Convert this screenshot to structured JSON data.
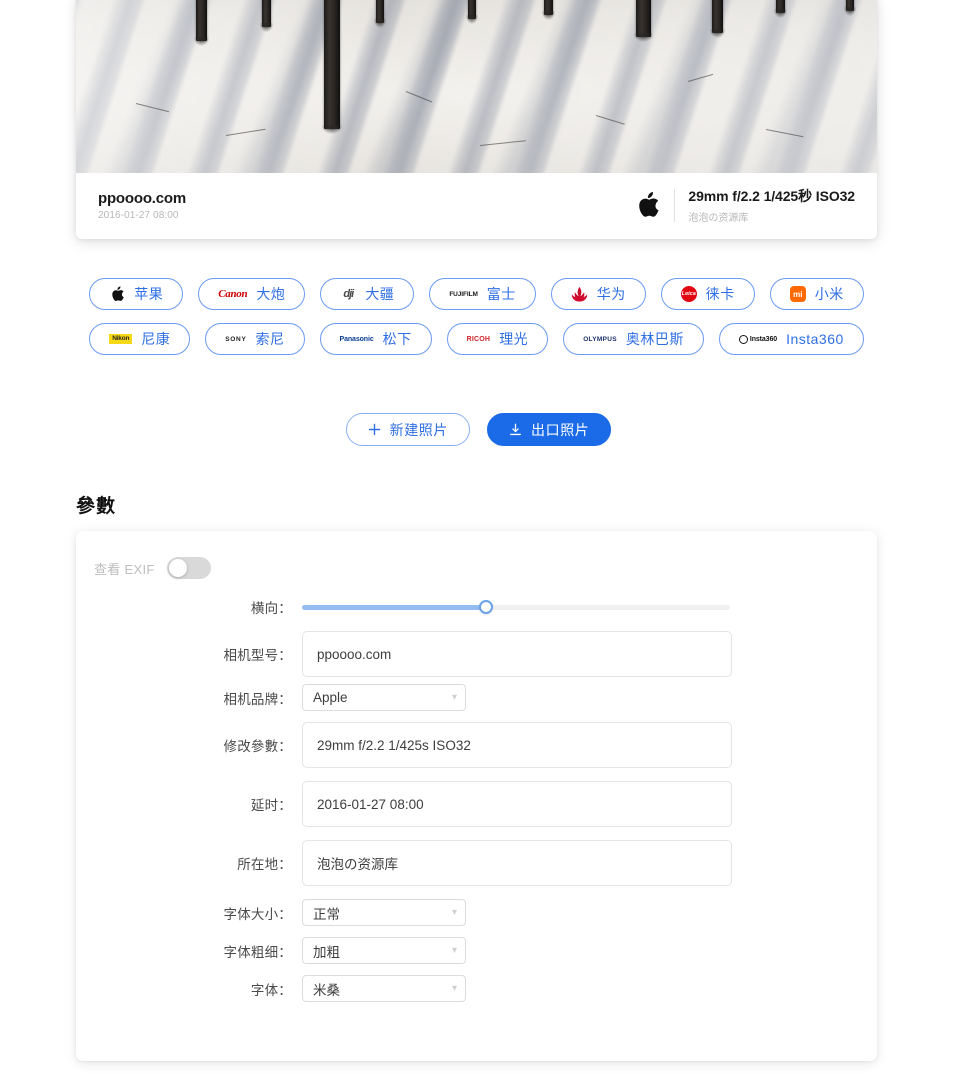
{
  "photo": {
    "alt_description": "snow-covered forest floor with dark tree trunks casting long shadows",
    "title": "ppoooo.com",
    "datetime": "2016-01-27 08:00",
    "brand_logo_icon": "apple-logo-icon",
    "params": "29mm f/2.2 1/425秒 ISO32",
    "owner": "泡泡の资源库"
  },
  "brands": [
    {
      "label": "苹果",
      "mark": "apple",
      "mark_text": "",
      "icon": "apple-logo-icon"
    },
    {
      "label": "大炮",
      "mark": "canon",
      "mark_text": "Canon",
      "icon": "canon-logo-icon"
    },
    {
      "label": "大疆",
      "mark": "dji",
      "mark_text": "dji",
      "icon": "dji-logo-icon"
    },
    {
      "label": "富士",
      "mark": "fuji",
      "mark_text": "FUJIFILM",
      "icon": "fujifilm-logo-icon"
    },
    {
      "label": "华为",
      "mark": "huawei",
      "mark_text": "HUAWEI",
      "icon": "huawei-logo-icon"
    },
    {
      "label": "徕卡",
      "mark": "leica",
      "mark_text": "Leica",
      "icon": "leica-logo-icon"
    },
    {
      "label": "小米",
      "mark": "xiaomi",
      "mark_text": "mi",
      "icon": "xiaomi-logo-icon"
    },
    {
      "label": "尼康",
      "mark": "nikon",
      "mark_text": "Nikon",
      "icon": "nikon-logo-icon"
    },
    {
      "label": "索尼",
      "mark": "sony",
      "mark_text": "SONY",
      "icon": "sony-logo-icon"
    },
    {
      "label": "松下",
      "mark": "pana",
      "mark_text": "Panasonic",
      "icon": "panasonic-logo-icon"
    },
    {
      "label": "理光",
      "mark": "ricoh",
      "mark_text": "RICOH",
      "icon": "ricoh-logo-icon"
    },
    {
      "label": "奥林巴斯",
      "mark": "olym",
      "mark_text": "OLYMPUS",
      "icon": "olympus-logo-icon"
    },
    {
      "label": "Insta360",
      "mark": "insta",
      "mark_text": "Insta360",
      "icon": "insta360-logo-icon"
    }
  ],
  "actions": {
    "new_photo": "新建照片",
    "new_photo_icon": "plus-icon",
    "export_photo": "出口照片",
    "export_photo_icon": "download-icon"
  },
  "params_section": {
    "heading": "參數",
    "exif_toggle_label": "查看 EXIF",
    "exif_toggle_on": false,
    "slider": {
      "label": "横向：",
      "value": 43,
      "min": 0,
      "max": 100
    },
    "fields": [
      {
        "label": "相机型号：",
        "value": "ppoooo.com",
        "type": "input"
      },
      {
        "label": "相机品牌：",
        "value": "Apple",
        "type": "select"
      },
      {
        "label": "修改參數：",
        "value": "29mm f/2.2 1/425s ISO32",
        "type": "input"
      },
      {
        "label": "延时：",
        "value": "2016-01-27 08:00",
        "type": "input"
      },
      {
        "label": "所在地：",
        "value": "泡泡の资源库",
        "type": "input"
      },
      {
        "label": "字体大小：",
        "value": "正常",
        "type": "select"
      },
      {
        "label": "字体粗细：",
        "value": "加粗",
        "type": "select"
      },
      {
        "label": "字体：",
        "value": "米桑",
        "type": "select"
      }
    ]
  },
  "colors": {
    "accent": "#2f6fe4",
    "primary_button": "#1b6ae8",
    "chip_border": "#6b9bf5",
    "slider_fill": "#93bcf0"
  }
}
